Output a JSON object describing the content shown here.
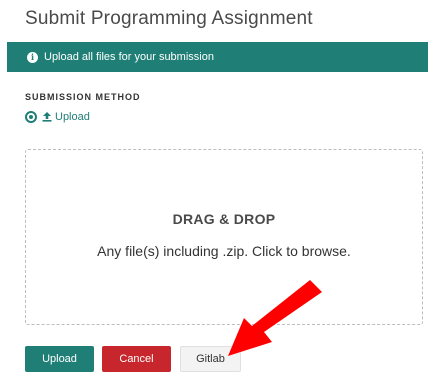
{
  "page": {
    "title": "Submit Programming Assignment"
  },
  "banner": {
    "icon": "info-icon",
    "text": "Upload all files for your submission",
    "color": "#1f7f76"
  },
  "submission_method": {
    "label": "SUBMISSION METHOD",
    "selected_option": "Upload",
    "icon": "upload-icon"
  },
  "dropzone": {
    "title": "DRAG & DROP",
    "subtitle": "Any file(s) including .zip. Click to browse."
  },
  "actions": {
    "upload_label": "Upload",
    "cancel_label": "Cancel",
    "gitlab_label": "Gitlab",
    "upload_color": "#1f7f76",
    "cancel_color": "#c7272c"
  },
  "annotation": {
    "arrow_color": "#ff0000",
    "points_to": "gitlab-button"
  }
}
